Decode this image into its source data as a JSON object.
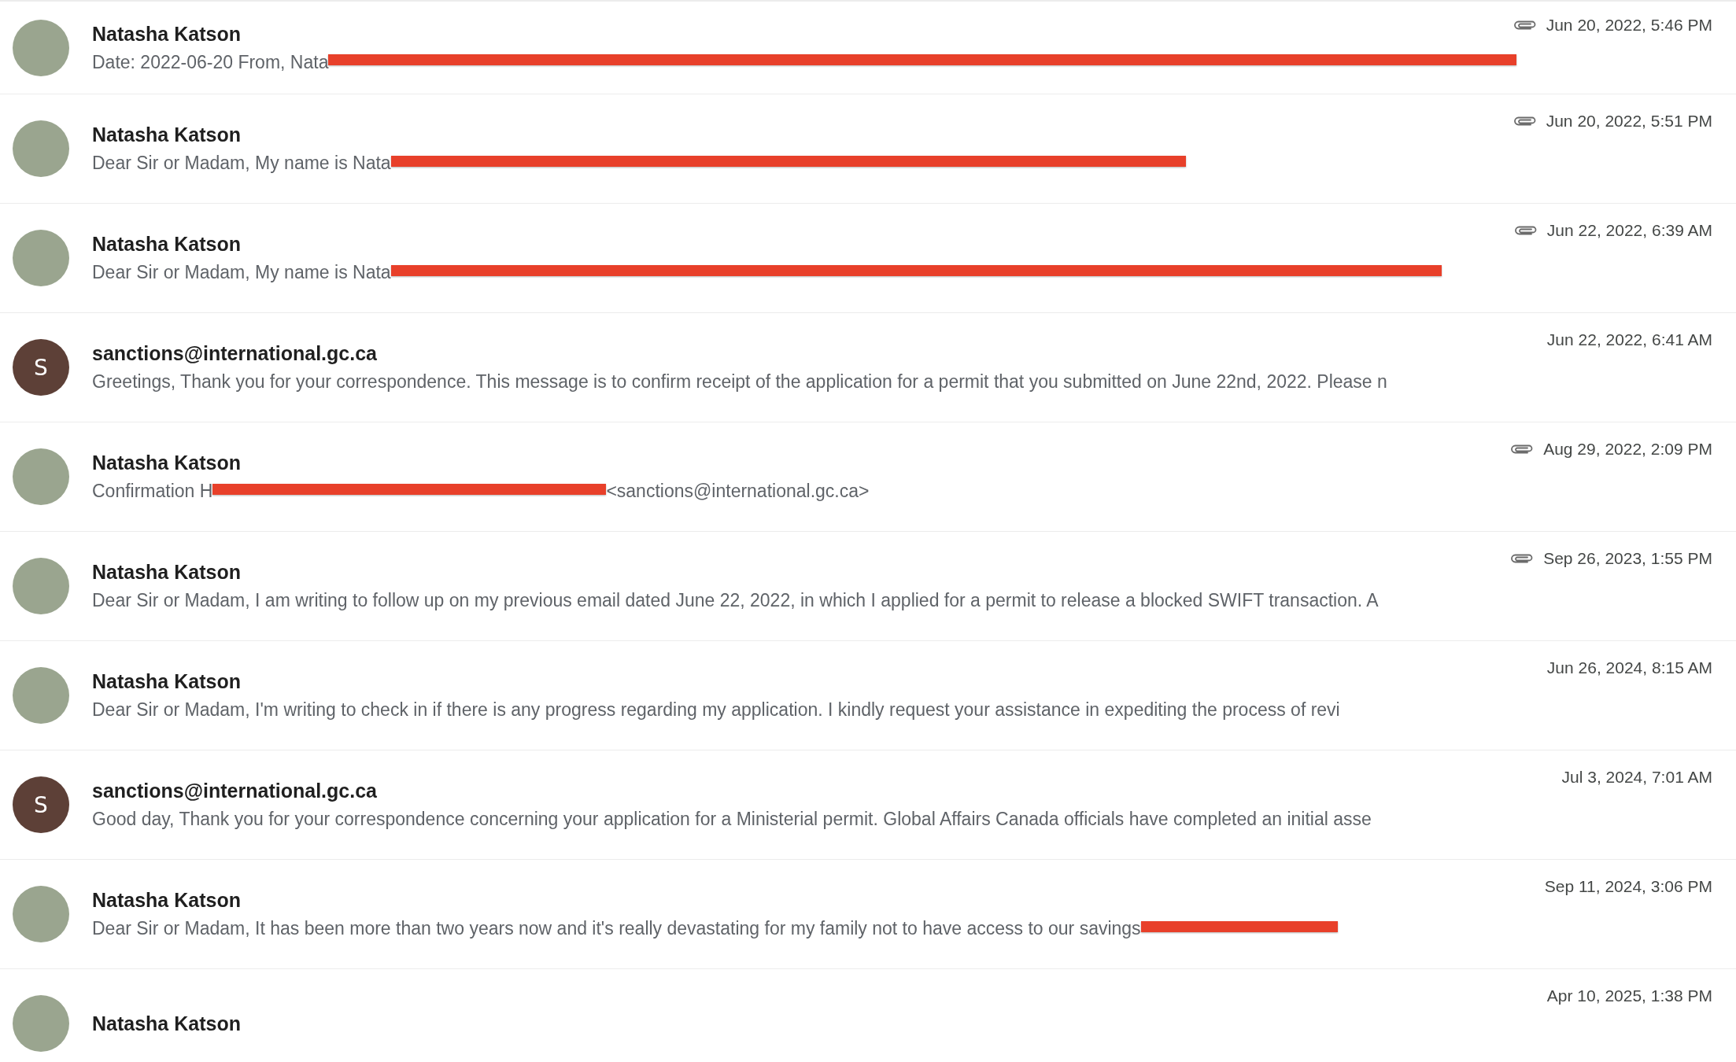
{
  "messages": [
    {
      "sender": "Natasha Katson",
      "avatar": {
        "kind": "photo"
      },
      "attachment": true,
      "date": "Jun 20, 2022, 5:46 PM",
      "snippet": "Date: 2022-06-20 From, Nata",
      "redacted": true
    },
    {
      "sender": "Natasha Katson",
      "avatar": {
        "kind": "photo"
      },
      "attachment": true,
      "date": "Jun 20, 2022, 5:51 PM",
      "snippet": "Dear Sir or Madam, My name is Nata",
      "redacted": true
    },
    {
      "sender": "Natasha Katson",
      "avatar": {
        "kind": "photo"
      },
      "attachment": true,
      "date": "Jun 22, 2022, 6:39 AM",
      "snippet": "Dear Sir or Madam, My name is Nata",
      "redacted": true
    },
    {
      "sender": "sanctions@international.gc.ca",
      "avatar": {
        "kind": "letter",
        "letter": "S"
      },
      "attachment": false,
      "date": "Jun 22, 2022, 6:41 AM",
      "snippet": "Greetings, Thank you for your correspondence. This message is to confirm receipt of the application for a permit that you submitted on June 22nd, 2022. Please n",
      "redacted": false
    },
    {
      "sender": "Natasha Katson",
      "avatar": {
        "kind": "photo"
      },
      "attachment": true,
      "date": "Aug 29, 2022, 2:09 PM",
      "snippet": "Confirmation H",
      "redacted": true,
      "snippet_after": "<sanctions@international.gc.ca>"
    },
    {
      "sender": "Natasha Katson",
      "avatar": {
        "kind": "photo"
      },
      "attachment": true,
      "date": "Sep 26, 2023, 1:55 PM",
      "snippet": "Dear Sir or Madam, I am writing to follow up on my previous email dated June 22, 2022, in which I applied for a permit to release a blocked SWIFT transaction. A",
      "redacted": false
    },
    {
      "sender": "Natasha Katson",
      "avatar": {
        "kind": "photo"
      },
      "attachment": false,
      "date": "Jun 26, 2024, 8:15 AM",
      "snippet": "Dear Sir or Madam, I'm writing to check in if there is any progress regarding my application. I kindly request your assistance in expediting the process of revi",
      "redacted": false
    },
    {
      "sender": "sanctions@international.gc.ca",
      "avatar": {
        "kind": "letter",
        "letter": "S"
      },
      "attachment": false,
      "date": "Jul 3, 2024, 7:01 AM",
      "snippet": "Good day, Thank you for your correspondence concerning your application for a Ministerial permit. Global Affairs Canada officials have completed an initial asse",
      "redacted": false
    },
    {
      "sender": "Natasha Katson",
      "avatar": {
        "kind": "photo"
      },
      "attachment": false,
      "date": "Sep 11, 2024, 3:06 PM",
      "snippet": "Dear Sir or Madam, It has been more than two years now and it's really devastating for my family not to have access to our savings",
      "redacted": true
    },
    {
      "sender": "Natasha Katson",
      "avatar": {
        "kind": "photo"
      },
      "attachment": false,
      "date": "Apr 10, 2025, 1:38 PM",
      "redacted": false
    }
  ]
}
